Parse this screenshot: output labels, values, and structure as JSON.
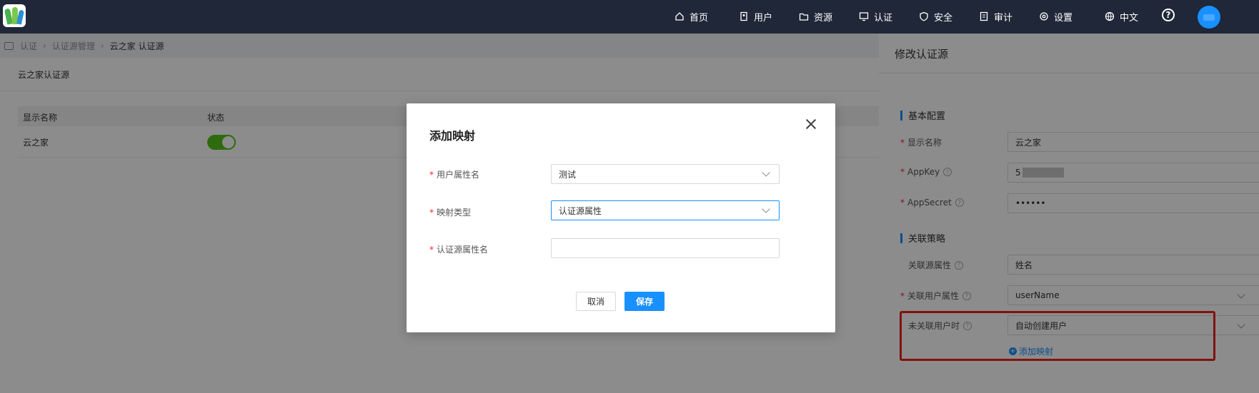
{
  "topnav": {
    "items": [
      {
        "label": "首页",
        "icon": "home-icon"
      },
      {
        "label": "用户",
        "icon": "user-icon"
      },
      {
        "label": "资源",
        "icon": "folder-icon"
      },
      {
        "label": "认证",
        "icon": "monitor-icon"
      },
      {
        "label": "安全",
        "icon": "shield-icon"
      },
      {
        "label": "审计",
        "icon": "audit-icon"
      },
      {
        "label": "设置",
        "icon": "gear-icon"
      },
      {
        "label": "中文",
        "icon": "globe-icon"
      }
    ],
    "help": "?"
  },
  "breadcrumb": [
    "认证",
    "认证源管理",
    "云之家 认证源"
  ],
  "page": {
    "title": "云之家认证源",
    "columns": [
      "显示名称",
      "状态"
    ],
    "rows": [
      {
        "name": "云之家",
        "enabled": true
      }
    ]
  },
  "drawer": {
    "title": "修改认证源",
    "section_basic": "基本配置",
    "display_name_label": "显示名称",
    "display_name_value": "云之家",
    "appkey_label": "AppKey",
    "appkey_value": "5",
    "appsecret_label": "AppSecret",
    "appsecret_value": "••••••",
    "section_link": "关联策略",
    "link_source_attr_label": "关联源属性",
    "link_source_attr_value": "姓名",
    "link_user_attr_label": "关联用户属性",
    "link_user_attr_value": "userName",
    "unlinked_label": "未关联用户时",
    "unlinked_value": "自动创建用户",
    "add_mapping": "添加映射"
  },
  "modal": {
    "title": "添加映射",
    "user_attr_label": "用户属性名",
    "user_attr_value": "测试",
    "map_type_label": "映射类型",
    "map_type_value": "认证源属性",
    "source_attr_label": "认证源属性名",
    "source_attr_value": "",
    "cancel": "取消",
    "save": "保存"
  },
  "colors": {
    "accent": "#1890ff",
    "topbar": "#1f2738",
    "toggle_on": "#52c41a",
    "highlight": "#e8231b"
  }
}
